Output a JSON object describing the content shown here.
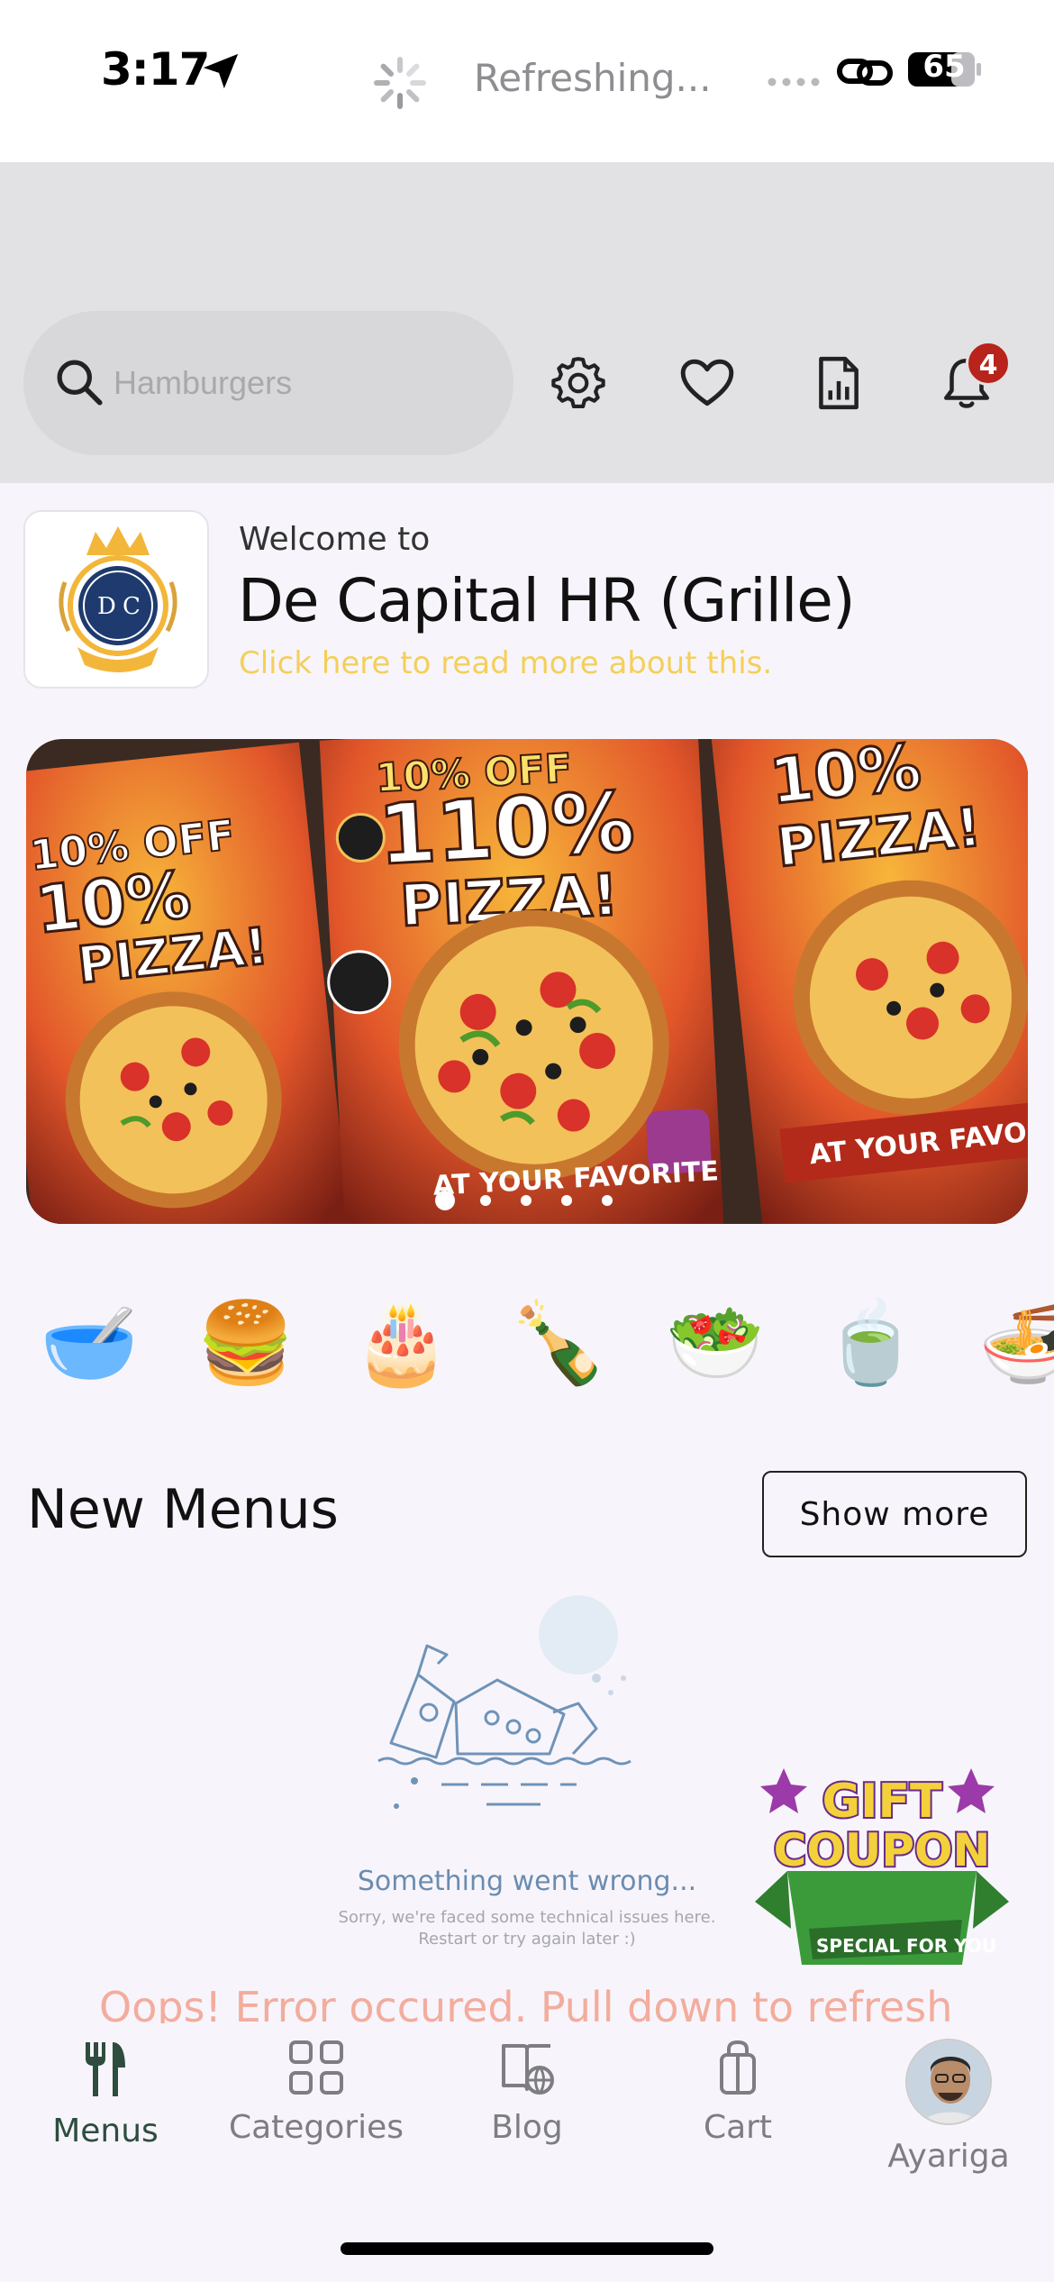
{
  "status_bar": {
    "time": "3:17",
    "refresh_text": "Refreshing...",
    "battery": "65"
  },
  "header": {
    "search_placeholder": "Hamburgers",
    "notification_count": "4"
  },
  "welcome": {
    "logo_initials_left": "D",
    "logo_initials_right": "C",
    "label": "Welcome to",
    "title": "De Capital HR (Grille)",
    "about_link": "Click here to read more about this."
  },
  "banner": {
    "image": "10% off pizza promotional flyers",
    "slide_count": 5,
    "active_slide": 1
  },
  "categories": [
    {
      "icon": "soup-bowl-icon",
      "glyph": "🥣"
    },
    {
      "icon": "hamburger-icon",
      "glyph": "🍔"
    },
    {
      "icon": "birthday-cake-icon",
      "glyph": "🎂"
    },
    {
      "icon": "wine-icon",
      "glyph": "🍾"
    },
    {
      "icon": "salad-icon",
      "glyph": "🥗"
    },
    {
      "icon": "tea-icon",
      "glyph": "🍵"
    },
    {
      "icon": "noodles-icon",
      "glyph": "🍜"
    }
  ],
  "new_menus": {
    "title": "New Menus",
    "show_more": "Show more",
    "error_title": "Something went wrong...",
    "error_subtitle": "Sorry, we're faced some technical issues here. Restart or try again later :)",
    "error_message": "Oops! Error occured. Pull down to refresh"
  },
  "gift_coupon": {
    "line1": "GIFT",
    "line2": "COUPON",
    "tag": "SPECIAL FOR YOU"
  },
  "tab_bar": {
    "tabs": [
      {
        "label": "Menus",
        "icon": "fork-knife-icon",
        "active": true
      },
      {
        "label": "Categories",
        "icon": "grid-icon",
        "active": false
      },
      {
        "label": "Blog",
        "icon": "book-globe-icon",
        "active": false
      },
      {
        "label": "Cart",
        "icon": "shopping-bag-icon",
        "active": false
      },
      {
        "label": "Ayariga",
        "icon": "profile-avatar",
        "active": false
      }
    ]
  },
  "colors": {
    "header_band": "#e2e2e4",
    "badge": "#b8231b",
    "about_link": "#f4cf5a",
    "error_message": "#f3ac9d",
    "active_tab": "#2e4d3f"
  }
}
